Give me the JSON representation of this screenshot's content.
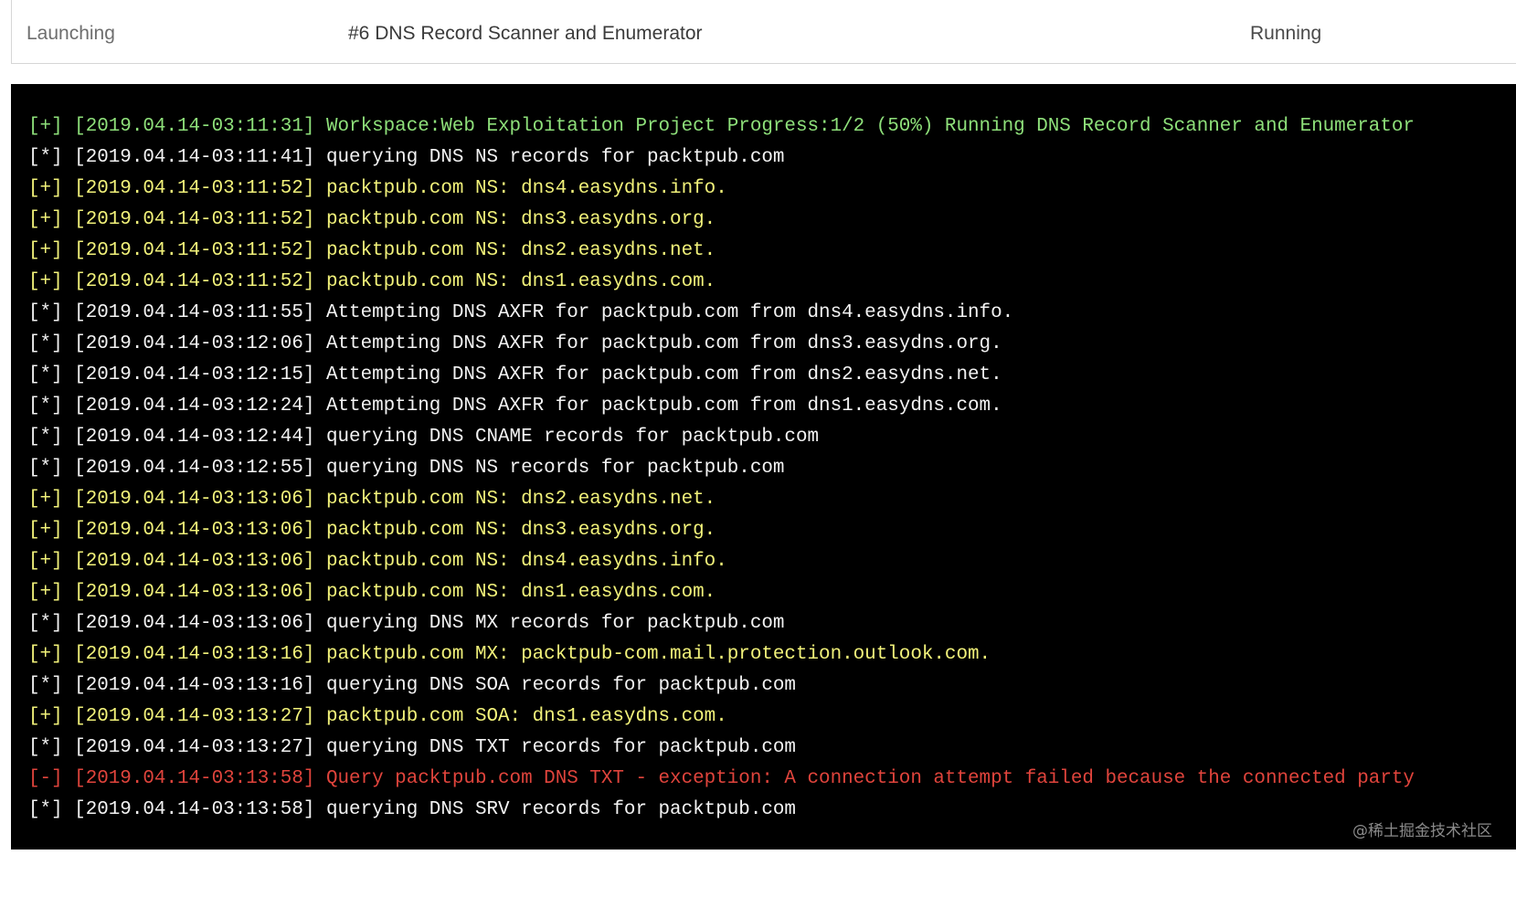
{
  "header": {
    "status": "Launching",
    "task": "#6 DNS Record Scanner and Enumerator",
    "state": "Running"
  },
  "colors": {
    "info": "#f3f3f3",
    "found": "#f2f27a",
    "status": "#8ee07a",
    "error": "#e0443c",
    "terminal_bg": "#000000"
  },
  "log": [
    {
      "level": "status",
      "prefix": "[+]",
      "timestamp": "[2019.04.14-03:11:31]",
      "message": "Workspace:Web Exploitation Project Progress:1/2 (50%) Running DNS Record Scanner and Enumerator"
    },
    {
      "level": "info",
      "prefix": "[*]",
      "timestamp": "[2019.04.14-03:11:41]",
      "message": "querying DNS NS records for packtpub.com"
    },
    {
      "level": "found",
      "prefix": "[+]",
      "timestamp": "[2019.04.14-03:11:52]",
      "message": "packtpub.com NS: dns4.easydns.info."
    },
    {
      "level": "found",
      "prefix": "[+]",
      "timestamp": "[2019.04.14-03:11:52]",
      "message": "packtpub.com NS: dns3.easydns.org."
    },
    {
      "level": "found",
      "prefix": "[+]",
      "timestamp": "[2019.04.14-03:11:52]",
      "message": "packtpub.com NS: dns2.easydns.net."
    },
    {
      "level": "found",
      "prefix": "[+]",
      "timestamp": "[2019.04.14-03:11:52]",
      "message": "packtpub.com NS: dns1.easydns.com."
    },
    {
      "level": "info",
      "prefix": "[*]",
      "timestamp": "[2019.04.14-03:11:55]",
      "message": "Attempting DNS AXFR for packtpub.com from dns4.easydns.info."
    },
    {
      "level": "info",
      "prefix": "[*]",
      "timestamp": "[2019.04.14-03:12:06]",
      "message": "Attempting DNS AXFR for packtpub.com from dns3.easydns.org."
    },
    {
      "level": "info",
      "prefix": "[*]",
      "timestamp": "[2019.04.14-03:12:15]",
      "message": "Attempting DNS AXFR for packtpub.com from dns2.easydns.net."
    },
    {
      "level": "info",
      "prefix": "[*]",
      "timestamp": "[2019.04.14-03:12:24]",
      "message": "Attempting DNS AXFR for packtpub.com from dns1.easydns.com."
    },
    {
      "level": "info",
      "prefix": "[*]",
      "timestamp": "[2019.04.14-03:12:44]",
      "message": "querying DNS CNAME records for packtpub.com"
    },
    {
      "level": "info",
      "prefix": "[*]",
      "timestamp": "[2019.04.14-03:12:55]",
      "message": "querying DNS NS records for packtpub.com"
    },
    {
      "level": "found",
      "prefix": "[+]",
      "timestamp": "[2019.04.14-03:13:06]",
      "message": "packtpub.com NS: dns2.easydns.net."
    },
    {
      "level": "found",
      "prefix": "[+]",
      "timestamp": "[2019.04.14-03:13:06]",
      "message": "packtpub.com NS: dns3.easydns.org."
    },
    {
      "level": "found",
      "prefix": "[+]",
      "timestamp": "[2019.04.14-03:13:06]",
      "message": "packtpub.com NS: dns4.easydns.info."
    },
    {
      "level": "found",
      "prefix": "[+]",
      "timestamp": "[2019.04.14-03:13:06]",
      "message": "packtpub.com NS: dns1.easydns.com."
    },
    {
      "level": "info",
      "prefix": "[*]",
      "timestamp": "[2019.04.14-03:13:06]",
      "message": "querying DNS MX records for packtpub.com"
    },
    {
      "level": "found",
      "prefix": "[+]",
      "timestamp": "[2019.04.14-03:13:16]",
      "message": "packtpub.com MX: packtpub-com.mail.protection.outlook.com."
    },
    {
      "level": "info",
      "prefix": "[*]",
      "timestamp": "[2019.04.14-03:13:16]",
      "message": "querying DNS SOA records for packtpub.com"
    },
    {
      "level": "found",
      "prefix": "[+]",
      "timestamp": "[2019.04.14-03:13:27]",
      "message": "packtpub.com SOA: dns1.easydns.com."
    },
    {
      "level": "info",
      "prefix": "[*]",
      "timestamp": "[2019.04.14-03:13:27]",
      "message": "querying DNS TXT records for packtpub.com"
    },
    {
      "level": "error",
      "prefix": "[-]",
      "timestamp": "[2019.04.14-03:13:58]",
      "message": "Query packtpub.com DNS TXT - exception: A connection attempt failed because the connected party"
    },
    {
      "level": "info",
      "prefix": "[*]",
      "timestamp": "[2019.04.14-03:13:58]",
      "message": "querying DNS SRV records for packtpub.com"
    }
  ],
  "watermark": "@稀土掘金技术社区"
}
